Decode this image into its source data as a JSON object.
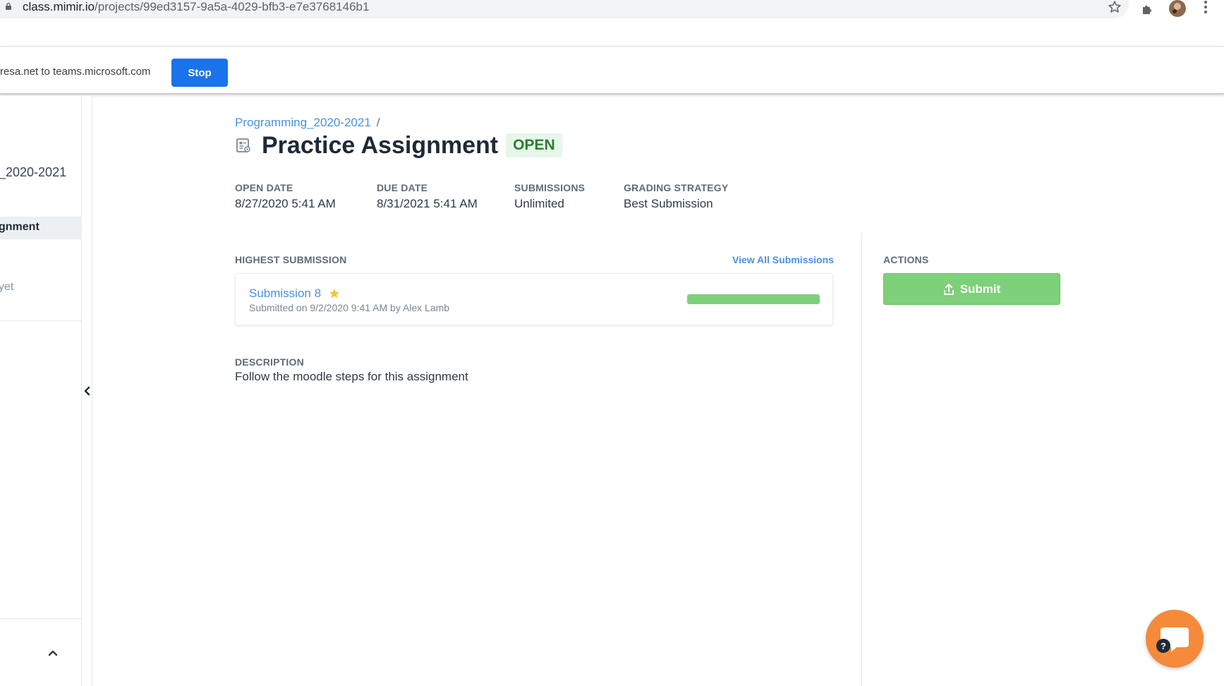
{
  "browser": {
    "url_host": "class.mimir.io",
    "url_path": "/projects/99ed3157-9a5a-4029-bfb3-e7e3768146b1"
  },
  "share_bar": {
    "text": "resa.net to teams.microsoft.com",
    "stop_label": "Stop"
  },
  "sidebar": {
    "course": "_2020-2021",
    "active_item": "gnment",
    "muted_item": "yet"
  },
  "breadcrumb": {
    "course_link": "Programming_2020-2021",
    "separator": "/"
  },
  "header": {
    "title": "Practice Assignment",
    "status": "OPEN"
  },
  "meta": {
    "open_date_label": "OPEN DATE",
    "open_date": "8/27/2020 5:41 AM",
    "due_date_label": "DUE DATE",
    "due_date": "8/31/2021 5:41 AM",
    "submissions_label": "SUBMISSIONS",
    "submissions": "Unlimited",
    "grading_label": "GRADING STRATEGY",
    "grading": "Best Submission"
  },
  "highest_submission": {
    "label": "HIGHEST SUBMISSION",
    "view_all": "View All Submissions",
    "name": "Submission 8",
    "submitted": "Submitted on 9/2/2020 9:41 AM by Alex Lamb",
    "progress_fraction": 1.0
  },
  "description": {
    "label": "DESCRIPTION",
    "text": "Follow the moodle steps for this assignment"
  },
  "actions": {
    "label": "ACTIONS",
    "submit_label": "Submit"
  },
  "colors": {
    "accent": "#4a90e2",
    "success": "#7ed07a",
    "help": "#f58a3b"
  }
}
